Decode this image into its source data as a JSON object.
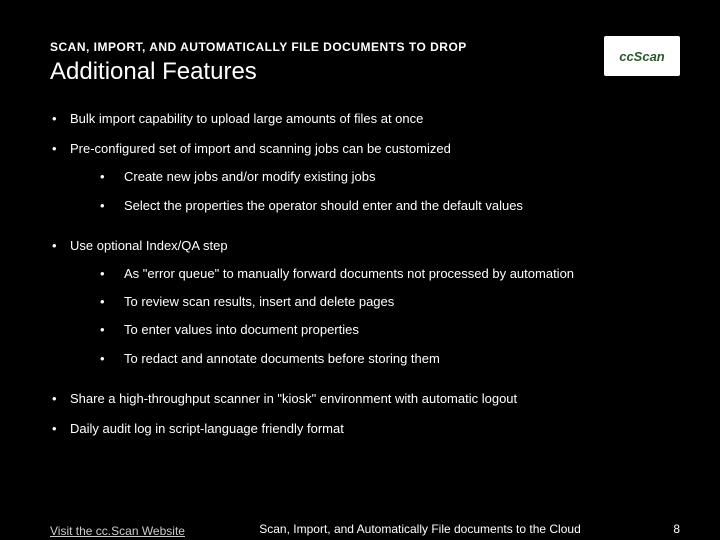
{
  "overline": "SCAN, IMPORT, AND AUTOMATICALLY FILE DOCUMENTS TO DROP",
  "title": "Additional Features",
  "logo_text": "ccScan",
  "bullets": [
    {
      "text": "Bulk import capability to upload large amounts of files at once",
      "sub": []
    },
    {
      "text": "Pre-configured set of import and scanning jobs can be customized",
      "sub": [
        "Create new jobs and/or modify existing jobs",
        "Select the properties the operator should enter and the default values"
      ]
    },
    {
      "text": "Use optional Index/QA step",
      "sub": [
        "As \"error queue\" to manually forward documents not processed by automation",
        "To review scan results, insert and delete pages",
        "To enter values into document properties",
        "To redact and annotate documents before storing them"
      ]
    },
    {
      "text": "Share a high-throughput scanner in \"kiosk\" environment with automatic logout",
      "sub": []
    },
    {
      "text": "Daily audit log in script-language friendly format",
      "sub": []
    }
  ],
  "footer": {
    "link": "Visit the cc.Scan Website",
    "center": "Scan, Import, and Automatically File documents to the Cloud",
    "page": "8"
  }
}
